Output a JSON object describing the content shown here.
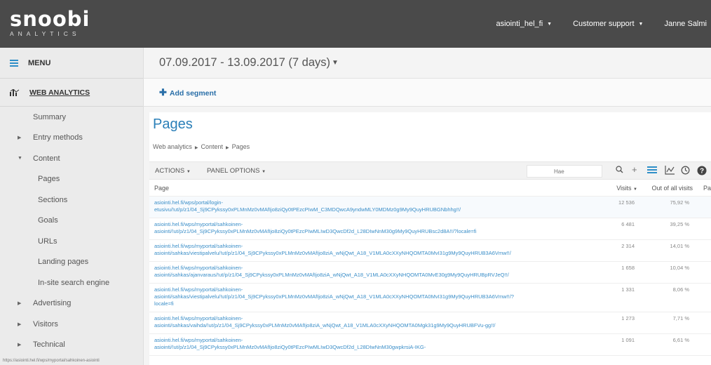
{
  "header": {
    "logo": "snoobi",
    "logo_sub": "ANALYTICS",
    "site": "asiointi_hel_fi",
    "support": "Customer support",
    "user": "Janne Salmi"
  },
  "sidebar": {
    "menu_label": "MENU",
    "section_label": "WEB ANALYTICS",
    "items": [
      {
        "label": "Summary"
      },
      {
        "label": "Entry methods"
      },
      {
        "label": "Content"
      },
      {
        "label": "Pages"
      },
      {
        "label": "Sections"
      },
      {
        "label": "Goals"
      },
      {
        "label": "URLs"
      },
      {
        "label": "Landing pages"
      },
      {
        "label": "In-site search engine"
      },
      {
        "label": "Advertising"
      },
      {
        "label": "Visitors"
      },
      {
        "label": "Technical"
      }
    ]
  },
  "main": {
    "date_range": "07.09.2017 - 13.09.2017 (7 days)",
    "add_segment": "Add segment",
    "title": "Pages",
    "breadcrumb": [
      "Web analytics",
      "Content",
      "Pages"
    ],
    "toolbar": {
      "actions": "ACTIONS",
      "panel_options": "PANEL OPTIONS",
      "search_placeholder": "Hae"
    },
    "table": {
      "columns": {
        "page": "Page",
        "visits": "Visits",
        "out_of_all": "Out of all visits",
        "pa": "Pa"
      },
      "rows": [
        {
          "line1": "asiointi.hel.fi/wps/portal/login-",
          "line2": "etusivu/!ut/p/z1/04_Sj9CPykssy0xPLMnMz0vMAfIjo8ziQy0tPEzcPIwM_C3MDQwcA9yndwMLY0MDMz0g9My9QuyHRUBGNbhhg!!/",
          "line3": "",
          "visits": "12 536",
          "pct": "75,92 %"
        },
        {
          "line1": "asiointi.hel.fi/wps/myportal/sahkoinen-",
          "line2": "asiointi/!ut/p/z1/04_Sj9CPykssy0xPLMnMz0vMAfIjo8ziQy0tPEzcPIwMLIwD3QwcDf2d_L28DIwNnM30g9My9QuyHRUBsc2d8A!!/?locale=fi",
          "line3": "",
          "visits": "6 481",
          "pct": "39,25 %"
        },
        {
          "line1": "asiointi.hel.fi/wps/myportal/sahkoinen-",
          "line2": "asiointi/sahkas/viestipalvelu/!ut/p/z1/04_Sj9CPykssy0xPLMnMz0vMAfIjo8ziA_wNjQwt_A18_V1MLA0cXXyNHQOMTA0MvI31g9My9QuyHRUB3A6Vmw!!/",
          "line3": "",
          "visits": "2 314",
          "pct": "14,01 %"
        },
        {
          "line1": "asiointi.hel.fi/wps/myportal/sahkoinen-",
          "line2": "asiointi/sahkas/ajanvaraus/!ut/p/z1/04_Sj9CPykssy0xPLMnMz0vMAfIjo8ziA_wNjQwt_A18_V1MLA0cXXyNHQOMTA0MvE30g9My9QuyHRUBpRVJeQ!!/",
          "line3": "",
          "visits": "1 658",
          "pct": "10,04 %"
        },
        {
          "line1": "asiointi.hel.fi/wps/myportal/sahkoinen-",
          "line2": "asiointi/sahkas/viestipalvelu/!ut/p/z1/04_Sj9CPykssy0xPLMnMz0vMAfIjo8ziA_wNjQwt_A18_V1MLA0cXXyNHQOMTA0MvI31g9My9QuyHRUB3A6Vmw!!/?",
          "line3": "locale=fi",
          "visits": "1 331",
          "pct": "8,06 %"
        },
        {
          "line1": "asiointi.hel.fi/wps/myportal/sahkoinen-",
          "line2": "asiointi/sahkas/vaihda/!ut/p/z1/04_Sj9CPykssy0xPLMnMz0vMAfIjo8ziA_wNjQwt_A18_V1MLA0cXXyNHQOMTA0Mgk31g9My9QuyHRUBFVu-gg!!/",
          "line3": "",
          "visits": "1 273",
          "pct": "7,71 %"
        },
        {
          "line1": "asiointi.hel.fi/wps/myportal/sahkoinen-",
          "line2": "asiointi/!ut/p/z1/04_Sj9CPykssy0xPLMnMz0vMAfIjo8ziQy0tPEzcPIwMLIwD3QwcDf2d_L28DIwNnM30gwpkrsiA-IKG-",
          "line3": "",
          "visits": "1 091",
          "pct": "6,61 %"
        }
      ]
    }
  },
  "status_bar": "https://asiointi.hel.fi/wps/myportal/sahkoinen-asiointi"
}
